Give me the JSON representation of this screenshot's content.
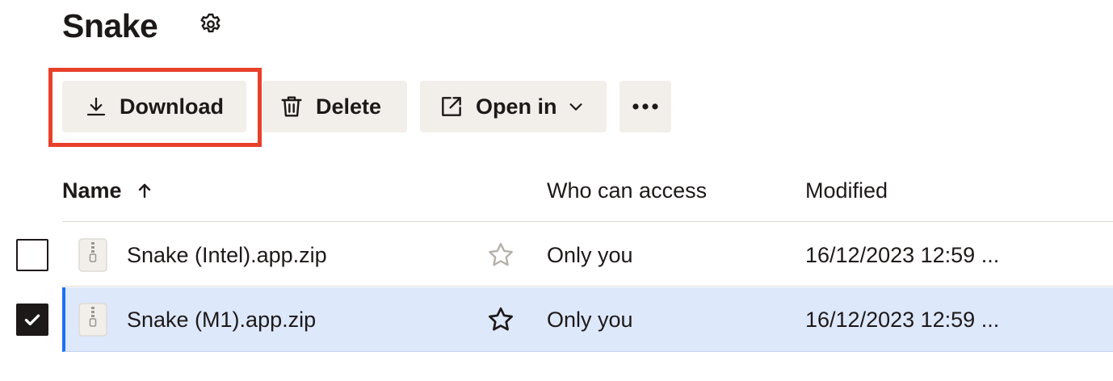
{
  "header": {
    "title": "Snake",
    "settings_icon": "gear-icon"
  },
  "toolbar": {
    "download_label": "Download",
    "download_icon": "download-icon",
    "delete_label": "Delete",
    "delete_icon": "trash-icon",
    "open_in_label": "Open in",
    "open_in_icon": "open-external-icon",
    "more_icon": "more-horizontal-icon"
  },
  "table": {
    "columns": {
      "name": "Name",
      "access": "Who can access",
      "modified": "Modified"
    },
    "sort": "ascending",
    "rows": [
      {
        "name": "Snake (Intel).app.zip",
        "access": "Only you",
        "modified": "16/12/2023 12:59 ...",
        "selected": false,
        "starred": false
      },
      {
        "name": "Snake (M1).app.zip",
        "access": "Only you",
        "modified": "16/12/2023 12:59 ...",
        "selected": true,
        "starred": false
      }
    ]
  },
  "colors": {
    "highlight_box": "#e8402a",
    "button_bg": "#f2efea",
    "selected_row_bg": "#dde8fb",
    "selected_row_accent": "#1e6ff3"
  }
}
